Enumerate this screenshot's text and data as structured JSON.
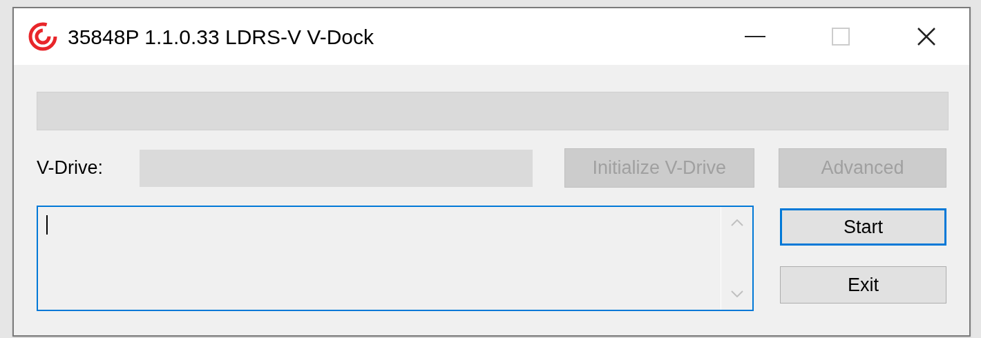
{
  "window": {
    "title": "35848P 1.1.0.33 LDRS-V V-Dock"
  },
  "vdrive": {
    "label": "V-Drive:"
  },
  "initialize_button": {
    "label": "Initialize V-Drive",
    "disabled": true
  },
  "advanced_button": {
    "label": "Advanced",
    "disabled": true
  },
  "log": {
    "focused": true
  },
  "start_button": {
    "label": "Start",
    "focused": true
  },
  "exit_button": {
    "label": "Exit",
    "focused": false
  }
}
